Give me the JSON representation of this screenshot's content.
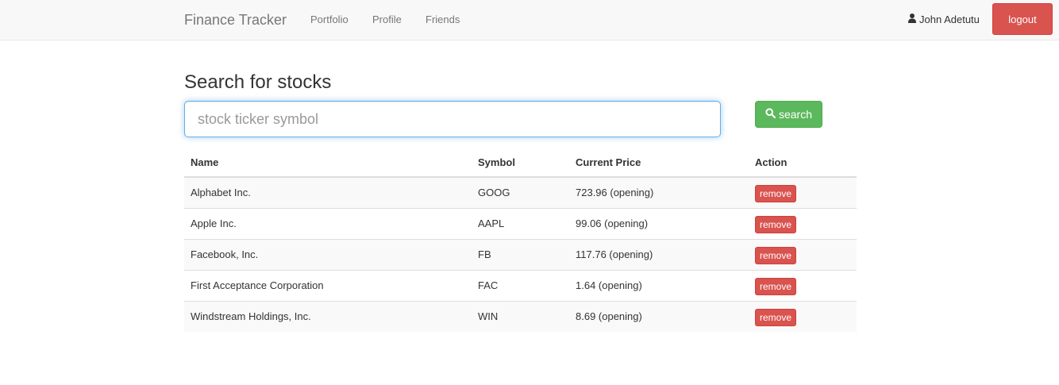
{
  "navbar": {
    "brand": "Finance Tracker",
    "links": [
      "Portfolio",
      "Profile",
      "Friends"
    ],
    "user_name": "John Adetutu",
    "user_icon": "user-icon",
    "logout_label": "logout"
  },
  "search": {
    "title": "Search for stocks",
    "placeholder": "stock ticker symbol",
    "value": "",
    "button_label": "search",
    "button_icon": "search-icon"
  },
  "table": {
    "headers": [
      "Name",
      "Symbol",
      "Current Price",
      "Action"
    ],
    "rows": [
      {
        "name": "Alphabet Inc.",
        "symbol": "GOOG",
        "price": "723.96 (opening)",
        "action": "remove"
      },
      {
        "name": "Apple Inc.",
        "symbol": "AAPL",
        "price": "99.06 (opening)",
        "action": "remove"
      },
      {
        "name": "Facebook, Inc.",
        "symbol": "FB",
        "price": "117.76 (opening)",
        "action": "remove"
      },
      {
        "name": "First Acceptance Corporation",
        "symbol": "FAC",
        "price": "1.64 (opening)",
        "action": "remove"
      },
      {
        "name": "Windstream Holdings, Inc.",
        "symbol": "WIN",
        "price": "8.69 (opening)",
        "action": "remove"
      }
    ]
  },
  "colors": {
    "danger": "#d9534f",
    "success": "#5cb85c",
    "navbar_bg": "#f8f8f8"
  }
}
